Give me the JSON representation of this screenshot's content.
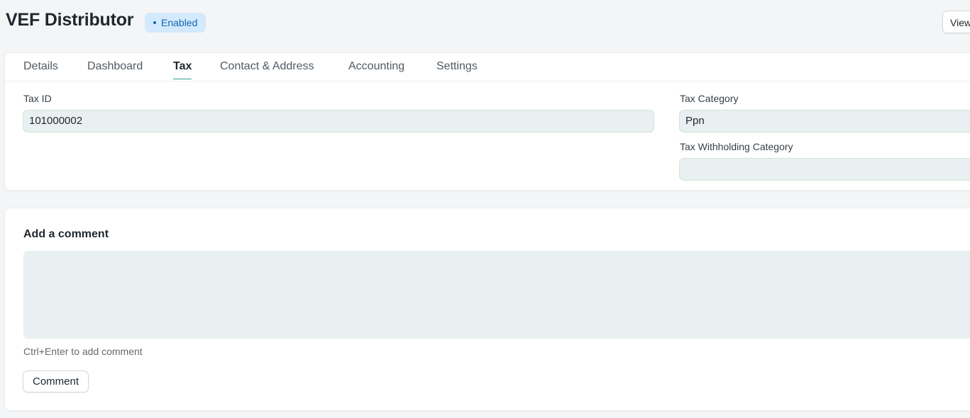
{
  "header": {
    "title": "VEF Distributor",
    "status_badge": "Enabled",
    "view_button": "View"
  },
  "tabs": [
    {
      "label": "Details",
      "active": false
    },
    {
      "label": "Dashboard",
      "active": false
    },
    {
      "label": "Tax",
      "active": true
    },
    {
      "label": "Contact & Address",
      "active": false
    },
    {
      "label": "Accounting",
      "active": false
    },
    {
      "label": "Settings",
      "active": false
    }
  ],
  "tax": {
    "tax_id_label": "Tax ID",
    "tax_id_value": "101000002",
    "tax_category_label": "Tax Category",
    "tax_category_value": "Ppn",
    "tax_withholding_label": "Tax Withholding Category",
    "tax_withholding_value": ""
  },
  "comment": {
    "title": "Add a comment",
    "hint": "Ctrl+Enter to add comment",
    "button": "Comment"
  },
  "colors": {
    "badge_bg": "#d3e9fc",
    "badge_text": "#1366ae",
    "field_bg": "#e9f0f2",
    "tab_underline": "#2e9c8b"
  }
}
